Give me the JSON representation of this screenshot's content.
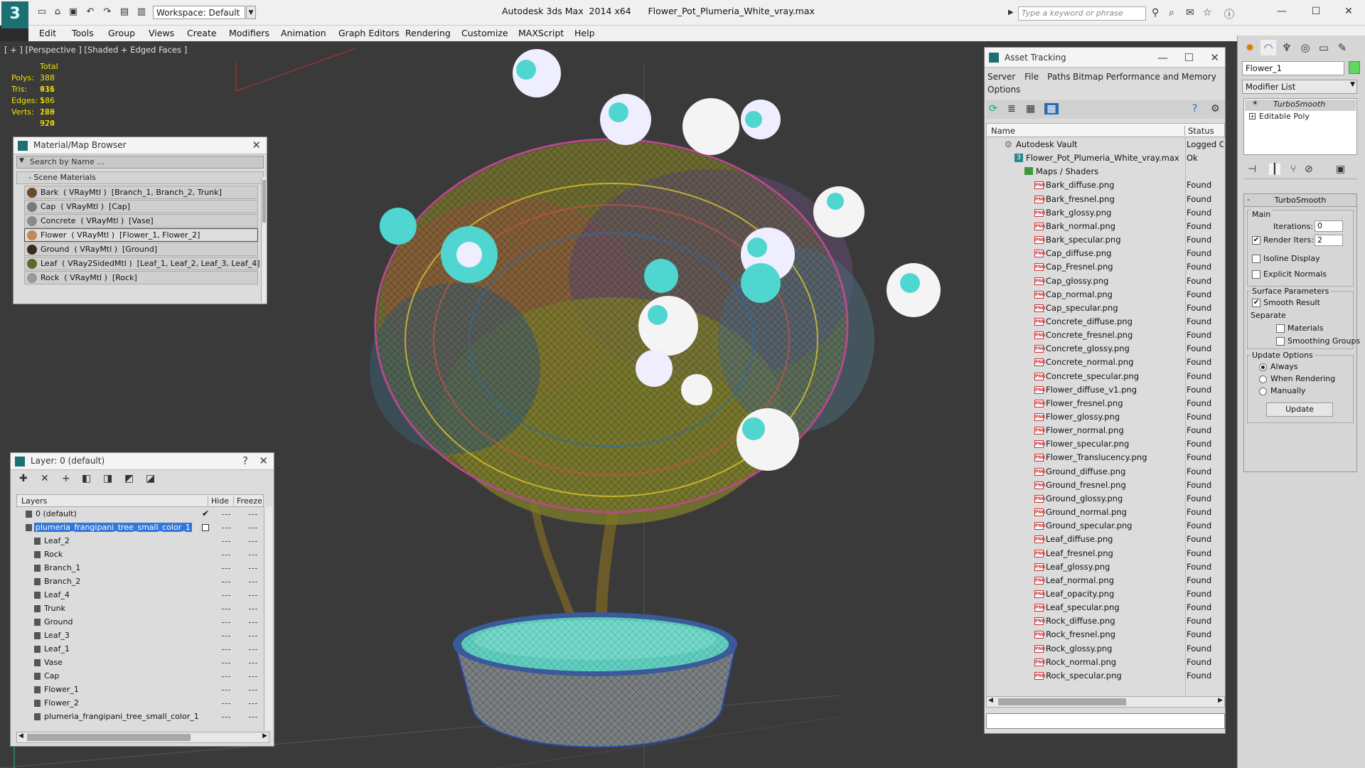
{
  "app": {
    "title": "Autodesk 3ds Max  2014 x64      Flower_Pot_Plumeria_White_vray.max",
    "workspace": "Workspace: Default",
    "search_placeholder": "Type a keyword or phrase"
  },
  "menu": [
    "Edit",
    "Tools",
    "Group",
    "Views",
    "Create",
    "Modifiers",
    "Animation",
    "Graph Editors",
    "Rendering",
    "Customize",
    "MAXScript",
    "Help"
  ],
  "viewport": {
    "label": "[ + ] [Perspective ] [Shaded + Edged Faces ]",
    "stats": {
      "header": "Total",
      "rows": [
        {
          "label": "Polys:",
          "value": "388 911"
        },
        {
          "label": "Tris:",
          "value": "436 586"
        },
        {
          "label": "Edges:",
          "value": "1 128 324"
        },
        {
          "label": "Verts:",
          "value": "269 970"
        }
      ]
    }
  },
  "material_browser": {
    "title": "Material/Map Browser",
    "search_placeholder": "Search by Name ...",
    "section": "- Scene Materials",
    "items": [
      {
        "label": "Bark  ( VRayMtl )  [Branch_1, Branch_2, Trunk]",
        "swatch": "#6b4a2a"
      },
      {
        "label": "Cap  ( VRayMtl )  [Cap]",
        "swatch": "#7a7a7a"
      },
      {
        "label": "Concrete  ( VRayMtl )  [Vase]",
        "swatch": "#8a8a8a"
      },
      {
        "label": "Flower  ( VRayMtl )  [Flower_1, Flower_2]",
        "swatch": "#c08a5a",
        "selected": true
      },
      {
        "label": "Ground  ( VRayMtl )  [Ground]",
        "swatch": "#3a2c1c"
      },
      {
        "label": "Leaf  ( VRay2SidedMtl )  [Leaf_1, Leaf_2, Leaf_3, Leaf_4]",
        "swatch": "#5a6a2a"
      },
      {
        "label": "Rock  ( VRayMtl )  [Rock]",
        "swatch": "#9a9a9a"
      }
    ]
  },
  "layer_panel": {
    "title": "Layer: 0 (default)",
    "help": "?",
    "columns": {
      "name": "Layers",
      "hide": "Hide",
      "freeze": "Freeze"
    },
    "rows": [
      {
        "name": "0 (default)",
        "indent": 0,
        "check": true
      },
      {
        "name": "plumeria_frangipani_tree_small_color_1",
        "indent": 0,
        "selected": true
      },
      {
        "name": "Leaf_2",
        "indent": 1
      },
      {
        "name": "Rock",
        "indent": 1
      },
      {
        "name": "Branch_1",
        "indent": 1
      },
      {
        "name": "Branch_2",
        "indent": 1
      },
      {
        "name": "Leaf_4",
        "indent": 1
      },
      {
        "name": "Trunk",
        "indent": 1
      },
      {
        "name": "Ground",
        "indent": 1
      },
      {
        "name": "Leaf_3",
        "indent": 1
      },
      {
        "name": "Leaf_1",
        "indent": 1
      },
      {
        "name": "Vase",
        "indent": 1
      },
      {
        "name": "Cap",
        "indent": 1
      },
      {
        "name": "Flower_1",
        "indent": 1
      },
      {
        "name": "Flower_2",
        "indent": 1
      },
      {
        "name": "plumeria_frangipani_tree_small_color_1",
        "indent": 1
      }
    ]
  },
  "asset_tracking": {
    "title": "Asset Tracking",
    "menu": [
      "Server",
      "File",
      "Paths",
      "Bitmap Performance and Memory",
      "Options"
    ],
    "columns": {
      "name": "Name",
      "status": "Status"
    },
    "rows": [
      {
        "name": "Autodesk Vault",
        "status": "Logged O",
        "indent": 1,
        "type": "vault"
      },
      {
        "name": "Flower_Pot_Plumeria_White_vray.max",
        "status": "Ok",
        "indent": 2,
        "type": "max"
      },
      {
        "name": "Maps / Shaders",
        "status": "",
        "indent": 3,
        "type": "folder"
      },
      {
        "name": "Bark_diffuse.png",
        "status": "Found",
        "indent": 4,
        "type": "png"
      },
      {
        "name": "Bark_fresnel.png",
        "status": "Found",
        "indent": 4,
        "type": "png"
      },
      {
        "name": "Bark_glossy.png",
        "status": "Found",
        "indent": 4,
        "type": "png"
      },
      {
        "name": "Bark_normal.png",
        "status": "Found",
        "indent": 4,
        "type": "png"
      },
      {
        "name": "Bark_specular.png",
        "status": "Found",
        "indent": 4,
        "type": "png"
      },
      {
        "name": "Cap_diffuse.png",
        "status": "Found",
        "indent": 4,
        "type": "png"
      },
      {
        "name": "Cap_Fresnel.png",
        "status": "Found",
        "indent": 4,
        "type": "png"
      },
      {
        "name": "Cap_glossy.png",
        "status": "Found",
        "indent": 4,
        "type": "png"
      },
      {
        "name": "Cap_normal.png",
        "status": "Found",
        "indent": 4,
        "type": "png"
      },
      {
        "name": "Cap_specular.png",
        "status": "Found",
        "indent": 4,
        "type": "png"
      },
      {
        "name": "Concrete_diffuse.png",
        "status": "Found",
        "indent": 4,
        "type": "png"
      },
      {
        "name": "Concrete_fresnel.png",
        "status": "Found",
        "indent": 4,
        "type": "png"
      },
      {
        "name": "Concrete_glossy.png",
        "status": "Found",
        "indent": 4,
        "type": "png"
      },
      {
        "name": "Concrete_normal.png",
        "status": "Found",
        "indent": 4,
        "type": "png"
      },
      {
        "name": "Concrete_specular.png",
        "status": "Found",
        "indent": 4,
        "type": "png"
      },
      {
        "name": "Flower_diffuse_v1.png",
        "status": "Found",
        "indent": 4,
        "type": "png"
      },
      {
        "name": "Flower_fresnel.png",
        "status": "Found",
        "indent": 4,
        "type": "png"
      },
      {
        "name": "Flower_glossy.png",
        "status": "Found",
        "indent": 4,
        "type": "png"
      },
      {
        "name": "Flower_normal.png",
        "status": "Found",
        "indent": 4,
        "type": "png"
      },
      {
        "name": "Flower_specular.png",
        "status": "Found",
        "indent": 4,
        "type": "png"
      },
      {
        "name": "Flower_Translucency.png",
        "status": "Found",
        "indent": 4,
        "type": "png"
      },
      {
        "name": "Ground_diffuse.png",
        "status": "Found",
        "indent": 4,
        "type": "png"
      },
      {
        "name": "Ground_fresnel.png",
        "status": "Found",
        "indent": 4,
        "type": "png"
      },
      {
        "name": "Ground_glossy.png",
        "status": "Found",
        "indent": 4,
        "type": "png"
      },
      {
        "name": "Ground_normal.png",
        "status": "Found",
        "indent": 4,
        "type": "png"
      },
      {
        "name": "Ground_specular.png",
        "status": "Found",
        "indent": 4,
        "type": "png"
      },
      {
        "name": "Leaf_diffuse.png",
        "status": "Found",
        "indent": 4,
        "type": "png"
      },
      {
        "name": "Leaf_fresnel.png",
        "status": "Found",
        "indent": 4,
        "type": "png"
      },
      {
        "name": "Leaf_glossy.png",
        "status": "Found",
        "indent": 4,
        "type": "png"
      },
      {
        "name": "Leaf_normal.png",
        "status": "Found",
        "indent": 4,
        "type": "png"
      },
      {
        "name": "Leaf_opacity.png",
        "status": "Found",
        "indent": 4,
        "type": "png"
      },
      {
        "name": "Leaf_specular.png",
        "status": "Found",
        "indent": 4,
        "type": "png"
      },
      {
        "name": "Rock_diffuse.png",
        "status": "Found",
        "indent": 4,
        "type": "png"
      },
      {
        "name": "Rock_fresnel.png",
        "status": "Found",
        "indent": 4,
        "type": "png"
      },
      {
        "name": "Rock_glossy.png",
        "status": "Found",
        "indent": 4,
        "type": "png"
      },
      {
        "name": "Rock_normal.png",
        "status": "Found",
        "indent": 4,
        "type": "png"
      },
      {
        "name": "Rock_specular.png",
        "status": "Found",
        "indent": 4,
        "type": "png"
      }
    ]
  },
  "command_panel": {
    "object_name": "Flower_1",
    "object_color": "#5ed85e",
    "modifier_list": "Modifier List",
    "stack": [
      {
        "name": "TurboSmooth",
        "italic": true,
        "selected": true
      },
      {
        "name": "Editable Poly",
        "italic": false
      }
    ],
    "turbosmooth": {
      "title": "TurboSmooth",
      "main": "Main",
      "iterations_label": "Iterations:",
      "iterations": "0",
      "render_iters_label": "Render Iters:",
      "render_iters": "2",
      "isoline": "Isoline Display",
      "explicit": "Explicit Normals",
      "surface": "Surface Parameters",
      "smooth_result": "Smooth Result",
      "separate": "Separate",
      "materials": "Materials",
      "smoothing_groups": "Smoothing Groups",
      "update_options": "Update Options",
      "always": "Always",
      "when_rendering": "When Rendering",
      "manually": "Manually",
      "update_button": "Update"
    }
  },
  "colors": {
    "accent": "#1c6f73",
    "selection": "#3377d8",
    "stats": "#f2e000"
  }
}
